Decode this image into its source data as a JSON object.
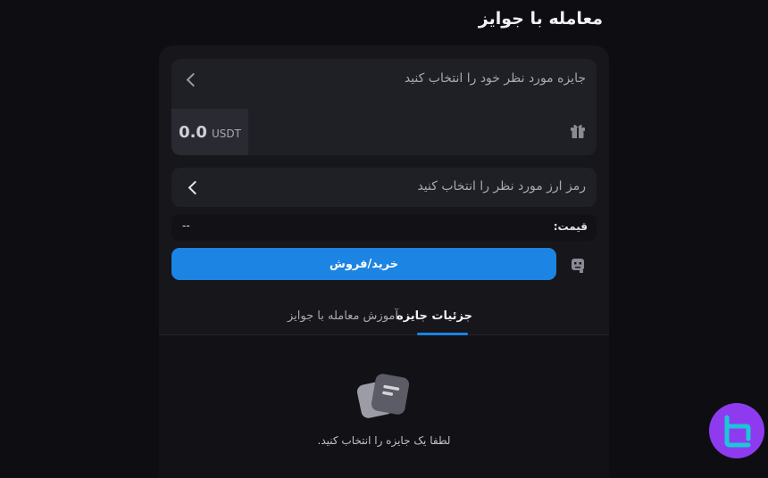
{
  "page": {
    "title": "معامله با جوایز"
  },
  "prize_selector": {
    "prompt": "جایزه مورد نظر خود را انتخاب کنید",
    "amount": "0.0",
    "unit": "USDT"
  },
  "coin_selector": {
    "prompt": "رمز ارز مورد نظر را انتخاب کنید"
  },
  "price": {
    "label": "قیمت:",
    "value": "--"
  },
  "trade_button": {
    "label": "خرید/فروش"
  },
  "tabs": [
    {
      "label": "جزئیات جایزه",
      "active": true
    },
    {
      "label": "آموزش معامله با جوایز",
      "active": false
    }
  ],
  "empty_state": {
    "message": "لطفا یک جایزه را انتخاب کنید."
  },
  "colors": {
    "accent": "#1c84e2",
    "background": "#0e0e12",
    "brand": "#8e3bf0"
  }
}
